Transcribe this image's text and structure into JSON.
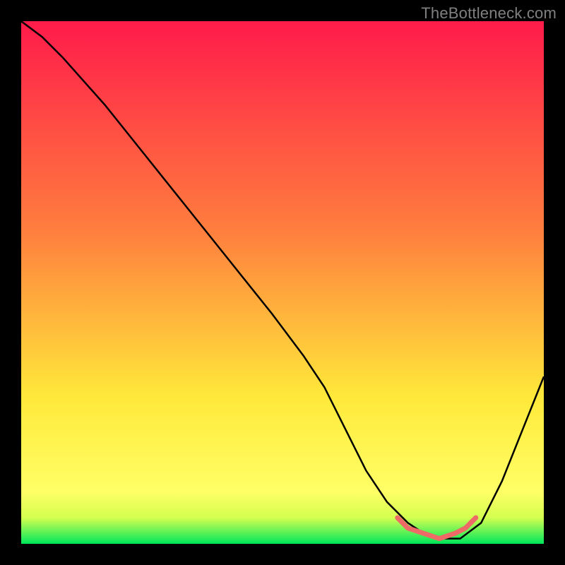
{
  "watermark": "TheBottleneck.com",
  "colors": {
    "page_bg": "#000000",
    "watermark": "#808080",
    "curve": "#000000",
    "salmon": "#ED6A66",
    "gradient_top": "#FF1B4A",
    "gradient_mid1": "#FF7E3E",
    "gradient_mid2": "#FFE93A",
    "gradient_bottom_yellow": "#FFFF66",
    "gradient_green": "#00E65B"
  },
  "chart_data": {
    "type": "line",
    "title": "",
    "xlabel": "",
    "ylabel": "",
    "xlim": [
      0,
      100
    ],
    "ylim": [
      0,
      100
    ],
    "series": [
      {
        "name": "bottleneck-curve",
        "x": [
          0,
          4,
          8,
          16,
          24,
          32,
          40,
          48,
          54,
          58,
          62,
          66,
          70,
          74,
          77,
          80,
          84,
          88,
          92,
          96,
          100
        ],
        "values": [
          100,
          97,
          93,
          84,
          74,
          64,
          54,
          44,
          36,
          30,
          22,
          14,
          8,
          4,
          2,
          1,
          1,
          4,
          12,
          22,
          32
        ]
      }
    ],
    "highlight_segment": {
      "name": "valley-floor",
      "color": "#ED6A66",
      "x": [
        72,
        74,
        77,
        80,
        83,
        85,
        87
      ],
      "values": [
        5,
        3,
        2,
        1,
        2,
        3,
        5
      ]
    },
    "background_gradient_stops": [
      {
        "offset": 0.0,
        "color": "#FF1B4A"
      },
      {
        "offset": 0.4,
        "color": "#FF7E3E"
      },
      {
        "offset": 0.72,
        "color": "#FFE93A"
      },
      {
        "offset": 0.9,
        "color": "#FFFF66"
      },
      {
        "offset": 0.95,
        "color": "#D4FF50"
      },
      {
        "offset": 1.0,
        "color": "#00E65B"
      }
    ]
  }
}
